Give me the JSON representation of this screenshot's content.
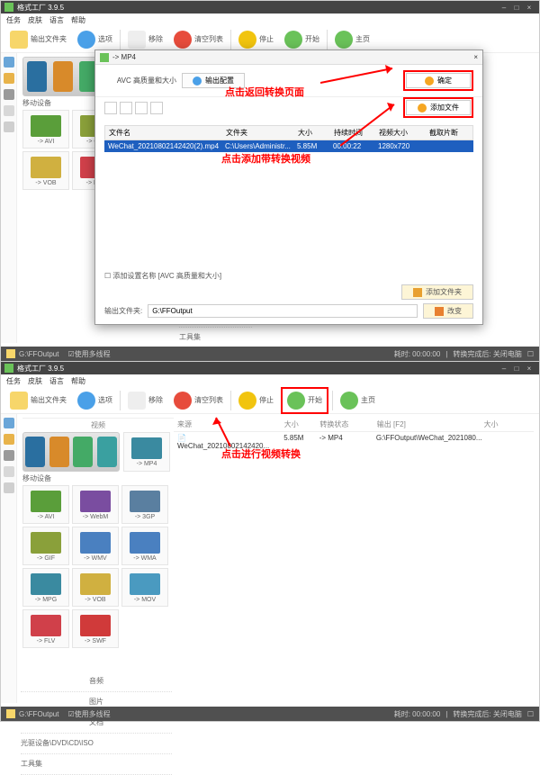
{
  "app": {
    "title": "格式工厂 3.9.5"
  },
  "menu": [
    "任务",
    "皮肤",
    "语言",
    "帮助"
  ],
  "toolbar": {
    "output_folder": "输出文件夹",
    "options": "选项",
    "remove": "移除",
    "clear_list": "清空列表",
    "stop": "停止",
    "start": "开始",
    "home": "主页"
  },
  "categories": {
    "video": "视频",
    "audio": "音频",
    "picture": "图片",
    "document": "文档",
    "device": "移动设备",
    "optical": "光驱设备\\DVD\\CD\\ISO",
    "toolset": "工具集"
  },
  "formats": {
    "avi": "-> AVI",
    "webm": "-> WebM",
    "gp": "-> 3GP",
    "gif": "-> GIF",
    "wmv": "-> WMV",
    "wma": "-> WMA",
    "mpg": "-> MPG",
    "vob": "-> VOB",
    "mov": "-> MOV",
    "flv": "-> FLV",
    "swf": "-> SWF",
    "mp4": "-> MP4"
  },
  "right_header": {
    "source": "来源",
    "size": "大小"
  },
  "dialog": {
    "title": "-> MP4",
    "profile": "AVC 高质量和大小",
    "output_config": "输出配置",
    "confirm": "确定",
    "add_file": "添加文件",
    "cols": {
      "name": "文件名",
      "folder": "文件夹",
      "size": "大小",
      "duration": "持续时间",
      "video_size": "视频大小",
      "clip": "截取片断"
    },
    "row": {
      "name": "WeChat_20210802142420(2).mp4",
      "folder": "C:\\Users\\Administr...",
      "size": "5.85M",
      "duration": "00:00:22",
      "video_size": "1280x720"
    },
    "add_setting": "添加设置名称 [AVC 高质量和大小]",
    "output_folder_label": "输出文件夹:",
    "output_path": "G:\\FFOutput",
    "add_folder": "添加文件夹",
    "change": "改变"
  },
  "anno": {
    "return_page": "点击返回转换页面",
    "add_video": "点击添加带转换视频",
    "start_convert": "点击进行视频转换"
  },
  "statusbar": {
    "output_path": "G:\\FFOutput",
    "multithread": "使用多线程",
    "elapsed": "耗时: 00:00:00",
    "after": "转换完成后: 关闭电脑"
  },
  "win2_list": {
    "cols": {
      "source": "来源",
      "size": "大小",
      "state": "转换状态",
      "output": "输出 [F2]",
      "outsize": "大小"
    },
    "row": {
      "source": "WeChat_20210802142420...",
      "size": "5.85M",
      "state": "-> MP4",
      "output": "G:\\FFOutput\\WeChat_2021080..."
    }
  }
}
